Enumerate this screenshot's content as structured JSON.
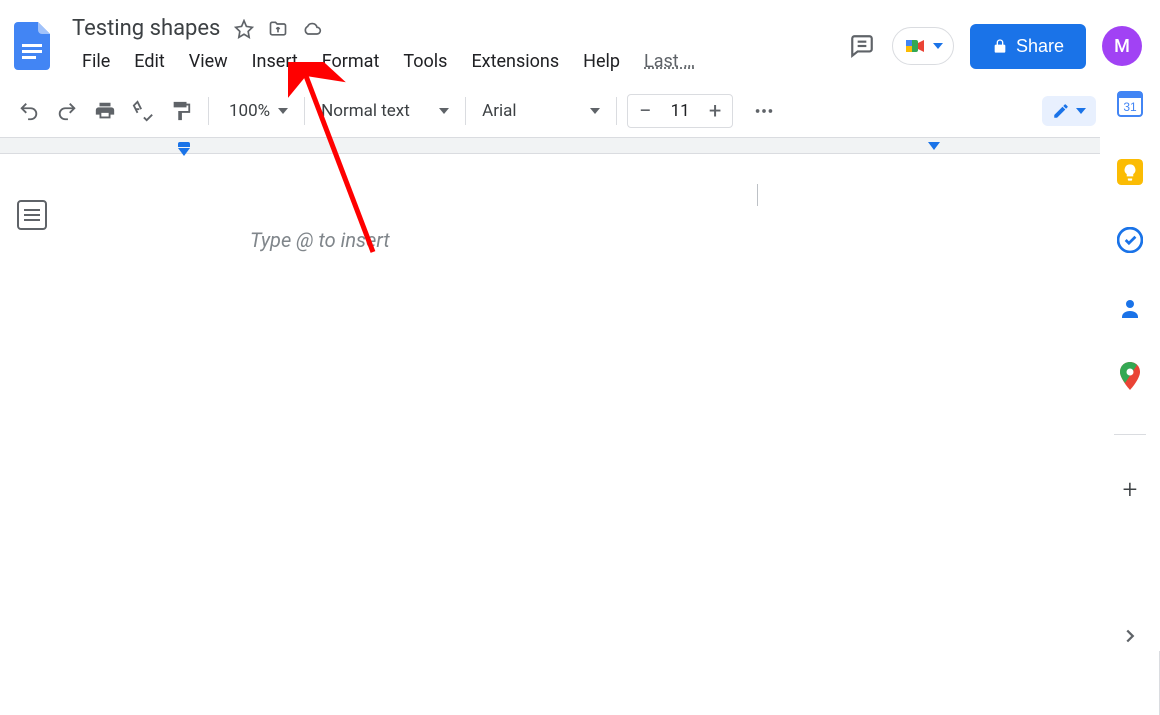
{
  "doc": {
    "title": "Testing shapes"
  },
  "menus": {
    "file": "File",
    "edit": "Edit",
    "view": "View",
    "insert": "Insert",
    "format": "Format",
    "tools": "Tools",
    "extensions": "Extensions",
    "help": "Help",
    "last": "Last …"
  },
  "toolbar": {
    "zoom": "100%",
    "style": "Normal text",
    "font": "Arial",
    "fontsize": "11"
  },
  "share": {
    "label": "Share"
  },
  "avatar": {
    "initial": "M"
  },
  "body": {
    "placeholder": "Type @ to insert"
  },
  "sidepanel": {
    "calendar_day": "31"
  }
}
